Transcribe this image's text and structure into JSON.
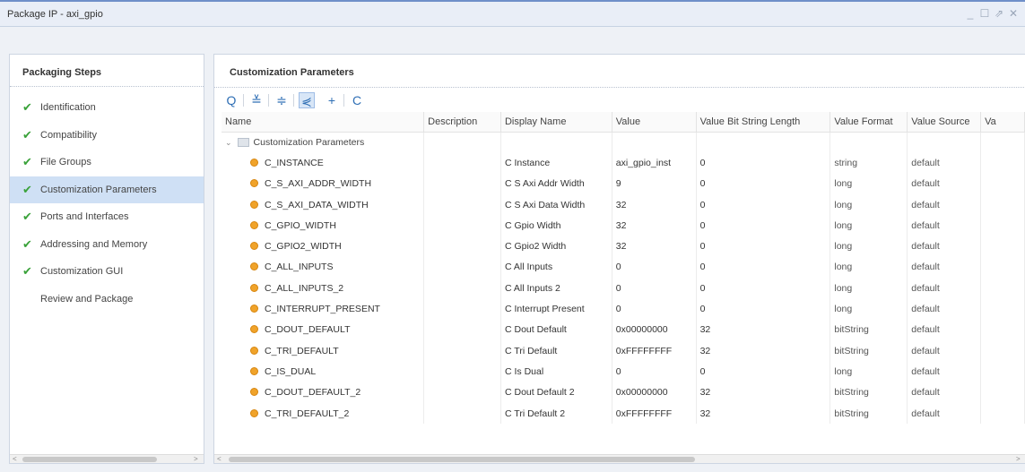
{
  "window": {
    "title": "Package IP - axi_gpio",
    "controls": [
      "_",
      "☐",
      "⇗",
      "✕"
    ]
  },
  "left_panel": {
    "header": "Packaging Steps",
    "steps": [
      {
        "label": "Identification",
        "done": true
      },
      {
        "label": "Compatibility",
        "done": true
      },
      {
        "label": "File Groups",
        "done": true
      },
      {
        "label": "Customization Parameters",
        "done": true,
        "selected": true
      },
      {
        "label": "Ports and Interfaces",
        "done": true
      },
      {
        "label": "Addressing and Memory",
        "done": true
      },
      {
        "label": "Customization GUI",
        "done": true
      },
      {
        "label": "Review and Package",
        "done": false
      }
    ]
  },
  "right_panel": {
    "header": "Customization Parameters",
    "toolbar": {
      "icons": [
        "search-icon",
        "collapse-all-icon",
        "expand-all-icon",
        "hierarchy-icon",
        "add-icon",
        "refresh-icon"
      ],
      "glyphs": [
        "Q",
        "≚",
        "≑",
        "⋞",
        "+",
        "C"
      ]
    },
    "columns": [
      "Name",
      "Description",
      "Display Name",
      "Value",
      "Value Bit String Length",
      "Value Format",
      "Value Source",
      "Va"
    ],
    "group_label": "Customization Parameters",
    "rows": [
      {
        "name": "C_INSTANCE",
        "description": "",
        "display": "C Instance",
        "value": "axi_gpio_inst",
        "bitlen": "0",
        "format": "string",
        "source": "default"
      },
      {
        "name": "C_S_AXI_ADDR_WIDTH",
        "description": "",
        "display": "C S Axi Addr Width",
        "value": "9",
        "bitlen": "0",
        "format": "long",
        "source": "default"
      },
      {
        "name": "C_S_AXI_DATA_WIDTH",
        "description": "",
        "display": "C S Axi Data Width",
        "value": "32",
        "bitlen": "0",
        "format": "long",
        "source": "default"
      },
      {
        "name": "C_GPIO_WIDTH",
        "description": "",
        "display": "C Gpio Width",
        "value": "32",
        "bitlen": "0",
        "format": "long",
        "source": "default"
      },
      {
        "name": "C_GPIO2_WIDTH",
        "description": "",
        "display": "C Gpio2 Width",
        "value": "32",
        "bitlen": "0",
        "format": "long",
        "source": "default"
      },
      {
        "name": "C_ALL_INPUTS",
        "description": "",
        "display": "C All Inputs",
        "value": "0",
        "bitlen": "0",
        "format": "long",
        "source": "default"
      },
      {
        "name": "C_ALL_INPUTS_2",
        "description": "",
        "display": "C All Inputs 2",
        "value": "0",
        "bitlen": "0",
        "format": "long",
        "source": "default"
      },
      {
        "name": "C_INTERRUPT_PRESENT",
        "description": "",
        "display": "C Interrupt Present",
        "value": "0",
        "bitlen": "0",
        "format": "long",
        "source": "default"
      },
      {
        "name": "C_DOUT_DEFAULT",
        "description": "",
        "display": "C Dout Default",
        "value": "0x00000000",
        "bitlen": "32",
        "format": "bitString",
        "source": "default"
      },
      {
        "name": "C_TRI_DEFAULT",
        "description": "",
        "display": "C Tri Default",
        "value": "0xFFFFFFFF",
        "bitlen": "32",
        "format": "bitString",
        "source": "default"
      },
      {
        "name": "C_IS_DUAL",
        "description": "",
        "display": "C Is Dual",
        "value": "0",
        "bitlen": "0",
        "format": "long",
        "source": "default"
      },
      {
        "name": "C_DOUT_DEFAULT_2",
        "description": "",
        "display": "C Dout Default 2",
        "value": "0x00000000",
        "bitlen": "32",
        "format": "bitString",
        "source": "default"
      },
      {
        "name": "C_TRI_DEFAULT_2",
        "description": "",
        "display": "C Tri Default 2",
        "value": "0xFFFFFFFF",
        "bitlen": "32",
        "format": "bitString",
        "source": "default"
      }
    ]
  },
  "colors": {
    "accent": "#6f8fc9",
    "selected_row": "#cfe0f5",
    "check": "#3aa23a",
    "param_icon": "#f0a32a"
  }
}
